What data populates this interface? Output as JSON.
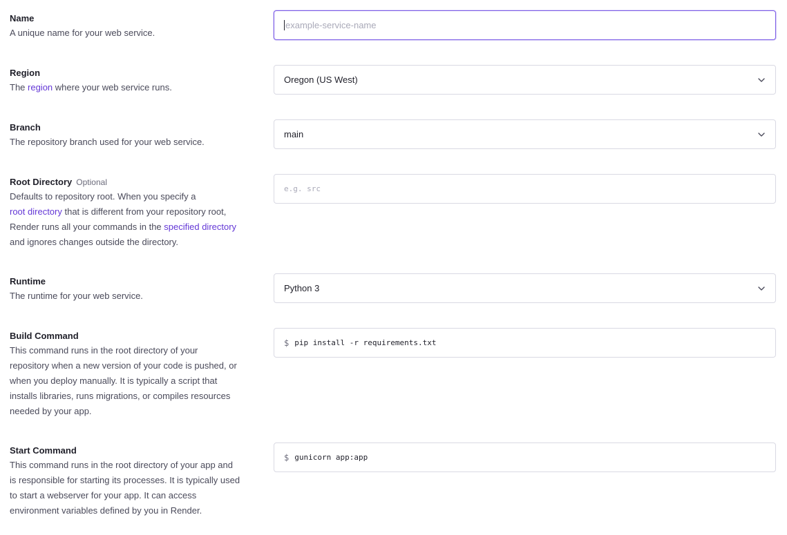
{
  "fields": {
    "name": {
      "label": "Name",
      "desc": "A unique name for your web service.",
      "placeholder": "example-service-name",
      "value": ""
    },
    "region": {
      "label": "Region",
      "desc_pre": "The ",
      "desc_link": "region",
      "desc_post": " where your web service runs.",
      "value": "Oregon (US West)"
    },
    "branch": {
      "label": "Branch",
      "desc": "The repository branch used for your web service.",
      "value": "main"
    },
    "root_directory": {
      "label": "Root Directory",
      "optional": "Optional",
      "desc_line1": "Defaults to repository root. When you specify a",
      "desc_link1": "root directory",
      "desc_mid": " that is different from your repository root,",
      "desc_line3_pre": "Render runs all your commands in the ",
      "desc_link2": "specified directory",
      "desc_line4": "and ignores changes outside the directory.",
      "placeholder": "e.g. src"
    },
    "runtime": {
      "label": "Runtime",
      "desc": "The runtime for your web service.",
      "value": "Python 3"
    },
    "build_command": {
      "label": "Build Command",
      "desc_lines": [
        "This command runs in the root directory of your",
        "repository when a new version of your code is pushed, or",
        "when you deploy manually. It is typically a script that",
        "installs libraries, runs migrations, or compiles resources",
        "needed by your app."
      ],
      "prefix": "$",
      "value": "pip install -r requirements.txt"
    },
    "start_command": {
      "label": "Start Command",
      "desc_lines": [
        "This command runs in the root directory of your app and",
        "is responsible for starting its processes. It is typically used",
        "to start a webserver for your app. It can access",
        "environment variables defined by you in Render."
      ],
      "prefix": "$",
      "value": "gunicorn app:app"
    }
  },
  "icons": {
    "dropdown": "chevron-down-icon"
  },
  "colors": {
    "link": "#6438d6",
    "focus_border": "#7b5ce6"
  }
}
